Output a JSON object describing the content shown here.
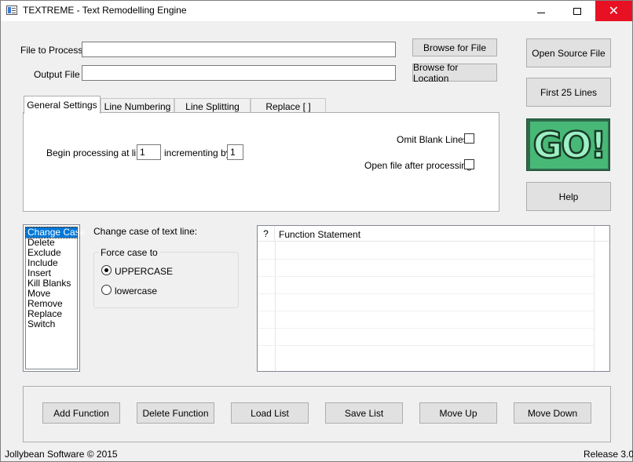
{
  "window": {
    "title": "TEXTREME - Text Remodelling Engine",
    "minimize": "minimize",
    "maximize": "maximize",
    "close": "✕"
  },
  "file": {
    "process_label": "File to Process",
    "process_value": "",
    "output_label": "Output File",
    "output_value": "",
    "browse_file": "Browse for File",
    "browse_location": "Browse for Location"
  },
  "side_buttons": {
    "open_source": "Open Source File",
    "first_25": "First 25 Lines",
    "go_logo": "GO!",
    "help": "Help"
  },
  "tabs": [
    {
      "label": "General Settings",
      "active": true
    },
    {
      "label": "Line Numbering",
      "active": false
    },
    {
      "label": "Line Splitting",
      "active": false
    },
    {
      "label": "Replace [ ]",
      "active": false
    }
  ],
  "general": {
    "begin_label": "Begin processing at line",
    "begin_value": "1",
    "increment_label": "incrementing by",
    "increment_value": "1",
    "omit_blank_label": "Omit Blank Lines",
    "omit_blank_checked": false,
    "open_after_label": "Open file after processing",
    "open_after_checked": false
  },
  "functions": {
    "items": [
      "Change Case",
      "Delete",
      "Exclude",
      "Include",
      "Insert",
      "Kill Blanks",
      "Move",
      "Remove",
      "Replace",
      "Switch"
    ],
    "selected": "Change Case",
    "description": "Change case of text line:",
    "group_label": "Force case to",
    "option_upper": "UPPERCASE",
    "option_lower": "lowercase",
    "selected_option": "UPPERCASE"
  },
  "grid": {
    "col_flag": "?",
    "col_statement": "Function Statement"
  },
  "actions": {
    "add": "Add Function",
    "delete": "Delete Function",
    "load": "Load List",
    "save": "Save List",
    "move_up": "Move Up",
    "move_down": "Move Down"
  },
  "status": {
    "copyright": "Jollybean Software © 2015",
    "release": "Release 3.0"
  }
}
